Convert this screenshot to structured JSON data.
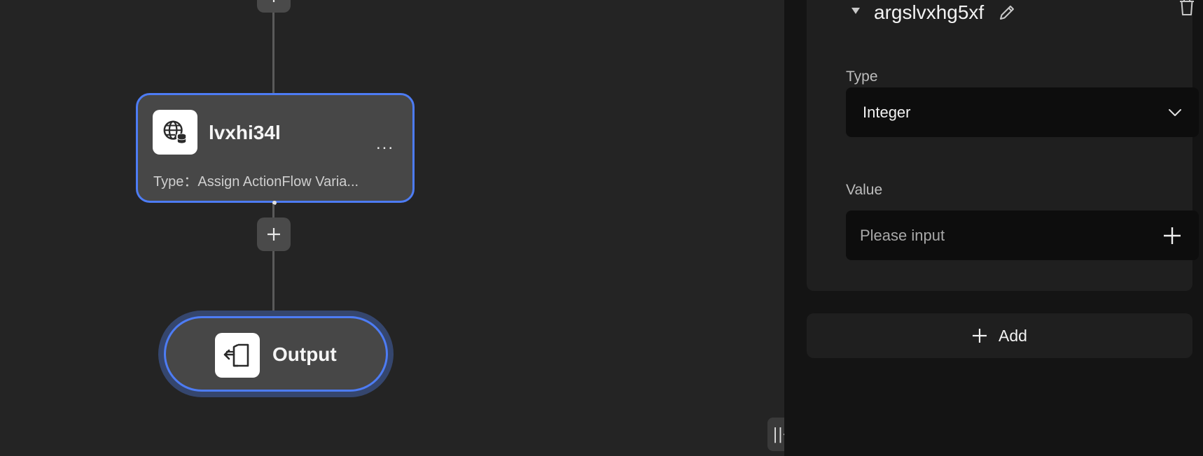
{
  "canvas": {
    "node": {
      "title": "lvxhi34l",
      "type_text": "Type：Assign ActionFlow Varia...",
      "more": "...",
      "icon": "globe-database-icon"
    },
    "output": {
      "label": "Output",
      "icon": "output-exit-icon"
    },
    "collapse_button": "||←"
  },
  "panel": {
    "argument": {
      "name": "argslvxhg5xf",
      "type_label": "Type",
      "type_value": "Integer",
      "value_label": "Value",
      "value_placeholder": "Please input"
    },
    "add_button": "Add"
  },
  "colors": {
    "accent": "#4d7cf4",
    "canvas_bg": "#242424",
    "panel_bg": "#141414"
  }
}
